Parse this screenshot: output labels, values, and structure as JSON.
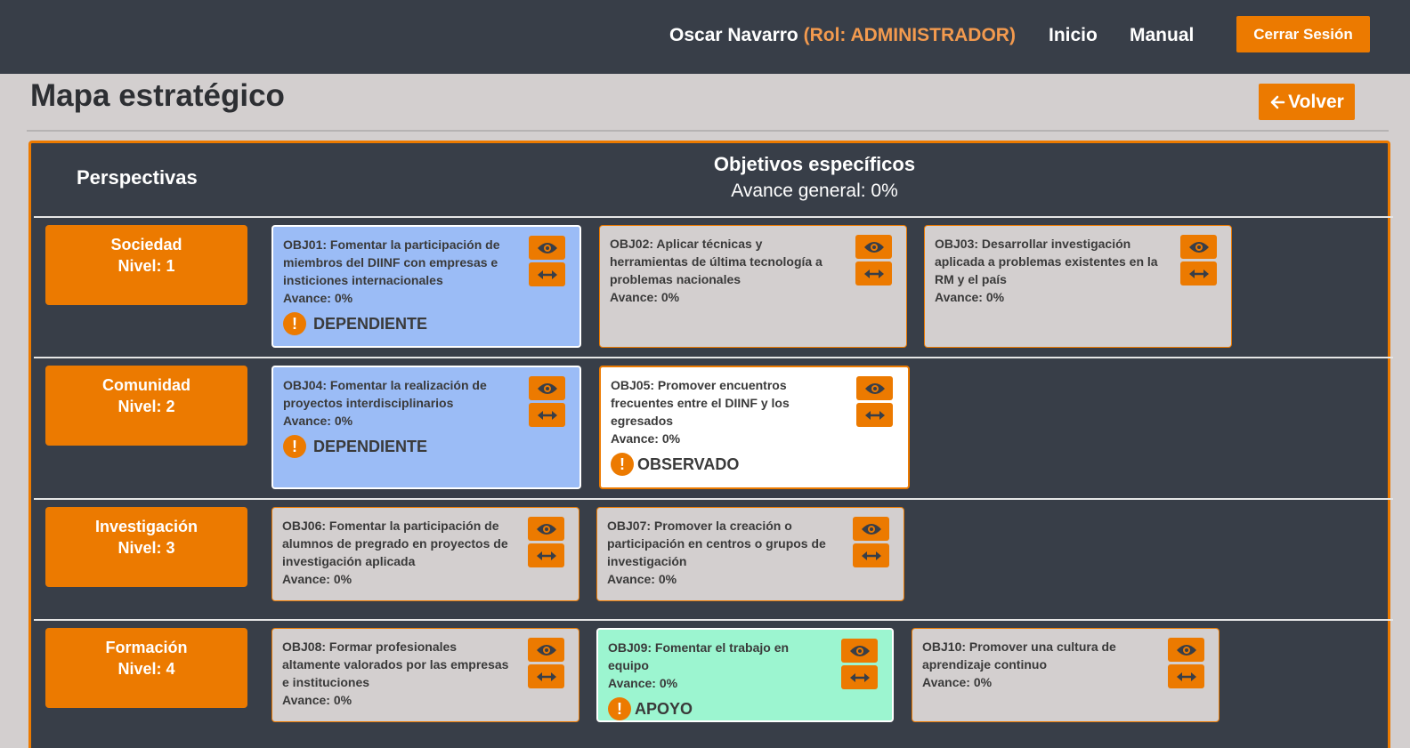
{
  "header": {
    "user_name": "Oscar Navarro",
    "role": "(Rol: ADMINISTRADOR)",
    "nav_inicio": "Inicio",
    "nav_manual": "Manual",
    "logout": "Cerrar Sesión"
  },
  "page": {
    "title": "Mapa estratégico",
    "back": "Volver"
  },
  "map": {
    "perspectives_header": "Perspectivas",
    "objectives_header": "Objetivos específicos",
    "general_progress": "Avance general: 0%"
  },
  "perspectives": [
    {
      "name": "Sociedad",
      "level": "Nivel: 1"
    },
    {
      "name": "Comunidad",
      "level": "Nivel: 2"
    },
    {
      "name": "Investigación",
      "level": "Nivel: 3"
    },
    {
      "name": "Formación",
      "level": "Nivel: 4"
    }
  ],
  "objectives": [
    {
      "text": "OBJ01: Fomentar la participación de miembros del DIINF con empresas e insticiones internacionales",
      "avance": "Avance: 0%",
      "status": "DEPENDIENTE",
      "color": "#9bbcf6"
    },
    {
      "text": "OBJ02: Aplicar técnicas y herramientas de última tecnología a problemas nacionales",
      "avance": "Avance: 0%",
      "status": "",
      "color": "#d3cfcf"
    },
    {
      "text": "OBJ03: Desarrollar investigación aplicada a problemas existentes en la RM y el país",
      "avance": "Avance: 0%",
      "status": "",
      "color": "#d3cfcf"
    },
    {
      "text": "OBJ04: Fomentar la realización de proyectos interdisciplinarios",
      "avance": "Avance: 0%",
      "status": "DEPENDIENTE",
      "color": "#9bbcf6"
    },
    {
      "text": "OBJ05: Promover encuentros frecuentes entre el DIINF y los egresados",
      "avance": "Avance: 0%",
      "status": "OBSERVADO",
      "color": "#ffffff"
    },
    {
      "text": "OBJ06: Fomentar la participación de alumnos de pregrado en proyectos de investigación aplicada",
      "avance": "Avance: 0%",
      "status": "",
      "color": "#d3cfcf"
    },
    {
      "text": "OBJ07: Promover la creación o participación en centros o grupos de investigación",
      "avance": "Avance: 0%",
      "status": "",
      "color": "#d3cfcf"
    },
    {
      "text": "OBJ08: Formar profesionales altamente valorados por las empresas e instituciones",
      "avance": "Avance: 0%",
      "status": "",
      "color": "#d3cfcf"
    },
    {
      "text": "OBJ09: Fomentar el trabajo en equipo",
      "avance": "Avance: 0%",
      "status": "APOYO",
      "color": "#9cf5d0"
    },
    {
      "text": "OBJ10: Promover una cultura de aprendizaje continuo",
      "avance": "Avance: 0%",
      "status": "",
      "color": "#d3cfcf"
    }
  ],
  "icons": {
    "view": "eye-icon",
    "relate": "double-arrow-icon",
    "status": "exclamation-icon",
    "back": "arrow-left-icon"
  },
  "colors": {
    "accent": "#ec7a00",
    "header_bg": "#383e48",
    "role_text": "#f39a4e"
  }
}
